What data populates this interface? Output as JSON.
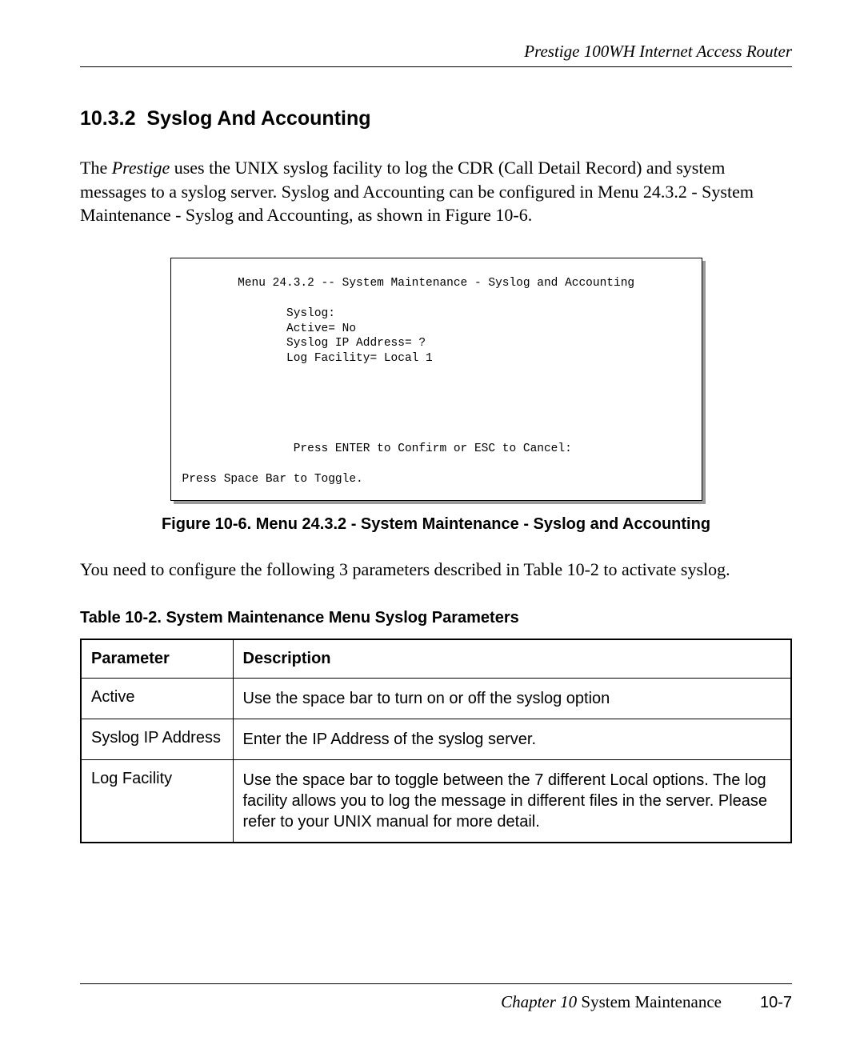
{
  "header": {
    "running": "Prestige 100WH Internet Access Router"
  },
  "section": {
    "number": "10.3.2",
    "title": "Syslog And Accounting"
  },
  "para1_pre": "The ",
  "para1_emph": "Prestige",
  "para1_post": " uses the UNIX syslog facility to log the CDR (Call Detail Record) and system messages to a syslog server. Syslog and Accounting can be configured in Menu 24.3.2 - System Maintenance - Syslog and Accounting, as shown in Figure 10-6.",
  "terminal": "        Menu 24.3.2 -- System Maintenance - Syslog and Accounting\n\n               Syslog:\n               Active= No\n               Syslog IP Address= ?\n               Log Facility= Local 1\n\n\n\n\n\n                Press ENTER to Confirm or ESC to Cancel:\n\nPress Space Bar to Toggle.",
  "figure_caption": "Figure 10-6.     Menu 24.3.2 - System Maintenance - Syslog and Accounting",
  "para2": "You need to configure the following 3 parameters described in Table 10-2 to activate syslog.",
  "table_caption": "Table 10-2.       System Maintenance Menu Syslog Parameters",
  "table": {
    "headers": {
      "c0": "Parameter",
      "c1": "Description"
    },
    "rows": [
      {
        "param": "Active",
        "desc": "Use the space bar to turn on or off the syslog option"
      },
      {
        "param": "Syslog IP Address",
        "desc": "Enter the IP Address of the syslog server."
      },
      {
        "param": "Log Facility",
        "desc": "Use the space bar to toggle between the 7 different Local options. The log facility allows you to log the message in different files in the server. Please refer to your UNIX manual for more detail."
      }
    ]
  },
  "footer": {
    "chapter_prefix": "Chapter 10",
    "chapter_title": " System Maintenance",
    "page": "10-7"
  }
}
